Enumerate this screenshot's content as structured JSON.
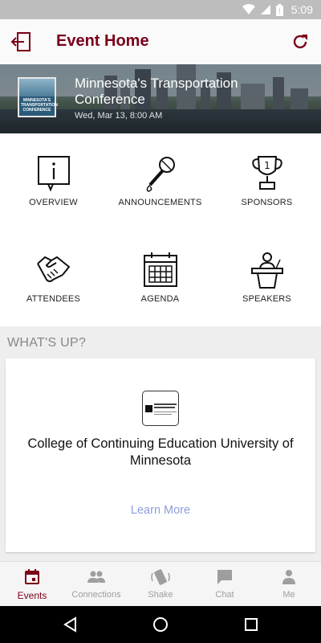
{
  "status_bar": {
    "time": "5:09"
  },
  "app_bar": {
    "title": "Event Home"
  },
  "event": {
    "name": "Minnesota's Transportation Conference",
    "date": "Wed, Mar 13, 8:00 AM",
    "logo_text": "MINNESOTA'S TRANSPORTATION CONFERENCE"
  },
  "tiles": [
    {
      "label": "OVERVIEW",
      "icon": "info-board-icon"
    },
    {
      "label": "ANNOUNCEMENTS",
      "icon": "microphone-icon"
    },
    {
      "label": "SPONSORS",
      "icon": "trophy-icon"
    },
    {
      "label": "ATTENDEES",
      "icon": "handshake-icon"
    },
    {
      "label": "AGENDA",
      "icon": "calendar-icon"
    },
    {
      "label": "SPEAKERS",
      "icon": "podium-icon"
    }
  ],
  "whats_up": {
    "title": "WHAT'S UP?",
    "card": {
      "org_name": "College of Continuing Education University of Minnesota",
      "learn_more": "Learn More"
    }
  },
  "bottom_nav": [
    {
      "label": "Events",
      "icon": "calendar-icon",
      "active": true
    },
    {
      "label": "Connections",
      "icon": "people-icon",
      "active": false
    },
    {
      "label": "Shake",
      "icon": "shake-phone-icon",
      "active": false
    },
    {
      "label": "Chat",
      "icon": "chat-icon",
      "active": false
    },
    {
      "label": "Me",
      "icon": "person-icon",
      "active": false
    }
  ],
  "colors": {
    "accent": "#7a0019",
    "link": "#8f9ddb",
    "inactive": "#9e9e9e"
  }
}
